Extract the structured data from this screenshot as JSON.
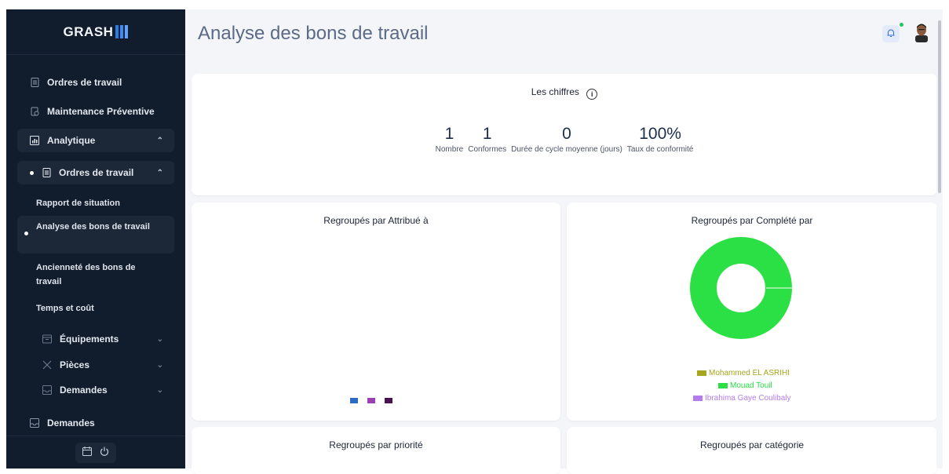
{
  "sidebar": {
    "logo": "GRASH",
    "items": [
      {
        "label": "Ordres de travail",
        "icon": "document-icon"
      },
      {
        "label": "Maintenance Préventive",
        "icon": "clipboard-clock-icon"
      },
      {
        "label": "Analytique",
        "icon": "chart-icon"
      },
      {
        "label": "Ordres de travail",
        "icon": "document-icon"
      }
    ],
    "sub_items": [
      {
        "label": "Rapport de situation"
      },
      {
        "label": "Analyse des bons de travail"
      },
      {
        "label": "Ancienneté des bons de travail"
      },
      {
        "label": "Temps et coût"
      }
    ],
    "analytics_items": [
      {
        "label": "Équipements",
        "icon": "box-icon"
      },
      {
        "label": "Pièces",
        "icon": "tools-icon"
      },
      {
        "label": "Demandes",
        "icon": "inbox-icon"
      }
    ],
    "bottom_item": {
      "label": "Demandes",
      "icon": "inbox-icon"
    },
    "bottom_buttons": {
      "calendar": "calendar-icon",
      "power": "power-icon"
    }
  },
  "header": {
    "title": "Analyse des bons de travail",
    "notification_icon": "alarm-icon"
  },
  "summary": {
    "title": "Les chiffres",
    "stats": [
      {
        "value": "1",
        "label": "Nombre"
      },
      {
        "value": "1",
        "label": "Conformes"
      },
      {
        "value": "0",
        "label": "Durée de cycle moyenne (jours)"
      },
      {
        "value": "100%",
        "label": "Taux de conformité"
      }
    ]
  },
  "cards": {
    "assigned_title": "Regroupés par Attribué à",
    "completed_title": "Regroupés par Complété par",
    "priority_title": "Regroupés par priorité",
    "category_title": "Regroupés par catégorie"
  },
  "chart_data": [
    {
      "type": "pie",
      "title": "Regroupés par Attribué à",
      "series": [
        {
          "color": "#2d6bc4",
          "value": 0
        },
        {
          "color": "#9b3fb5",
          "value": 0
        },
        {
          "color": "#4a1250",
          "value": 0
        }
      ]
    },
    {
      "type": "pie",
      "title": "Regroupés par Complété par",
      "categories": [
        "Mohammed EL ASRIHI",
        "Mouad Touil",
        "Ibrahima Gaye Coulibaly"
      ],
      "values": [
        0,
        1,
        0
      ],
      "colors": [
        "#a3a61e",
        "#2be044",
        "#b57cf0"
      ]
    }
  ],
  "colors": {
    "sidebar_bg": "#111c2d",
    "main_bg": "#f4f5f8",
    "accent": "#2d6cdf",
    "donut_green": "#2be044"
  }
}
